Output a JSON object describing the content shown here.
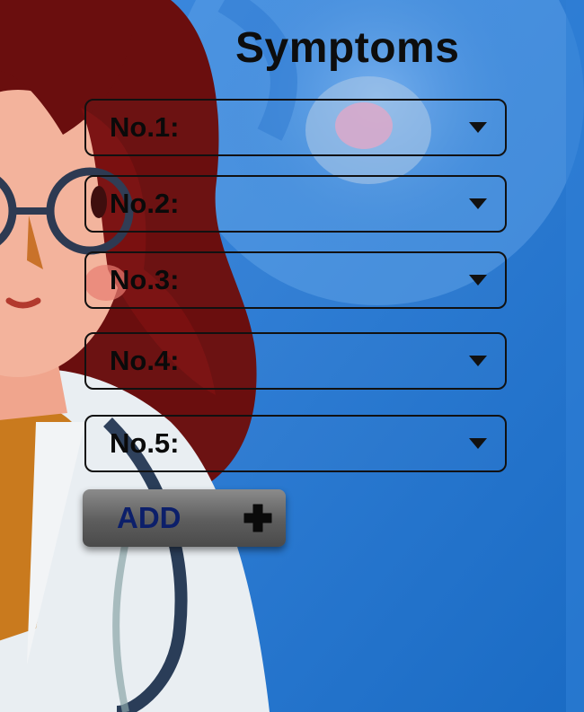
{
  "header": {
    "title": "Symptoms"
  },
  "symptoms": {
    "fields": [
      {
        "label": "No.1:"
      },
      {
        "label": "No.2:"
      },
      {
        "label": "No.3:"
      },
      {
        "label": "No.4:"
      },
      {
        "label": "No.5:"
      }
    ]
  },
  "actions": {
    "add_label": "ADD"
  },
  "icons": {
    "dropdown": "caret-down-icon",
    "add": "plus-icon"
  },
  "colors": {
    "background": "#1f72c9",
    "title": "#0d0d0d",
    "add_text": "#0c1f6a"
  }
}
